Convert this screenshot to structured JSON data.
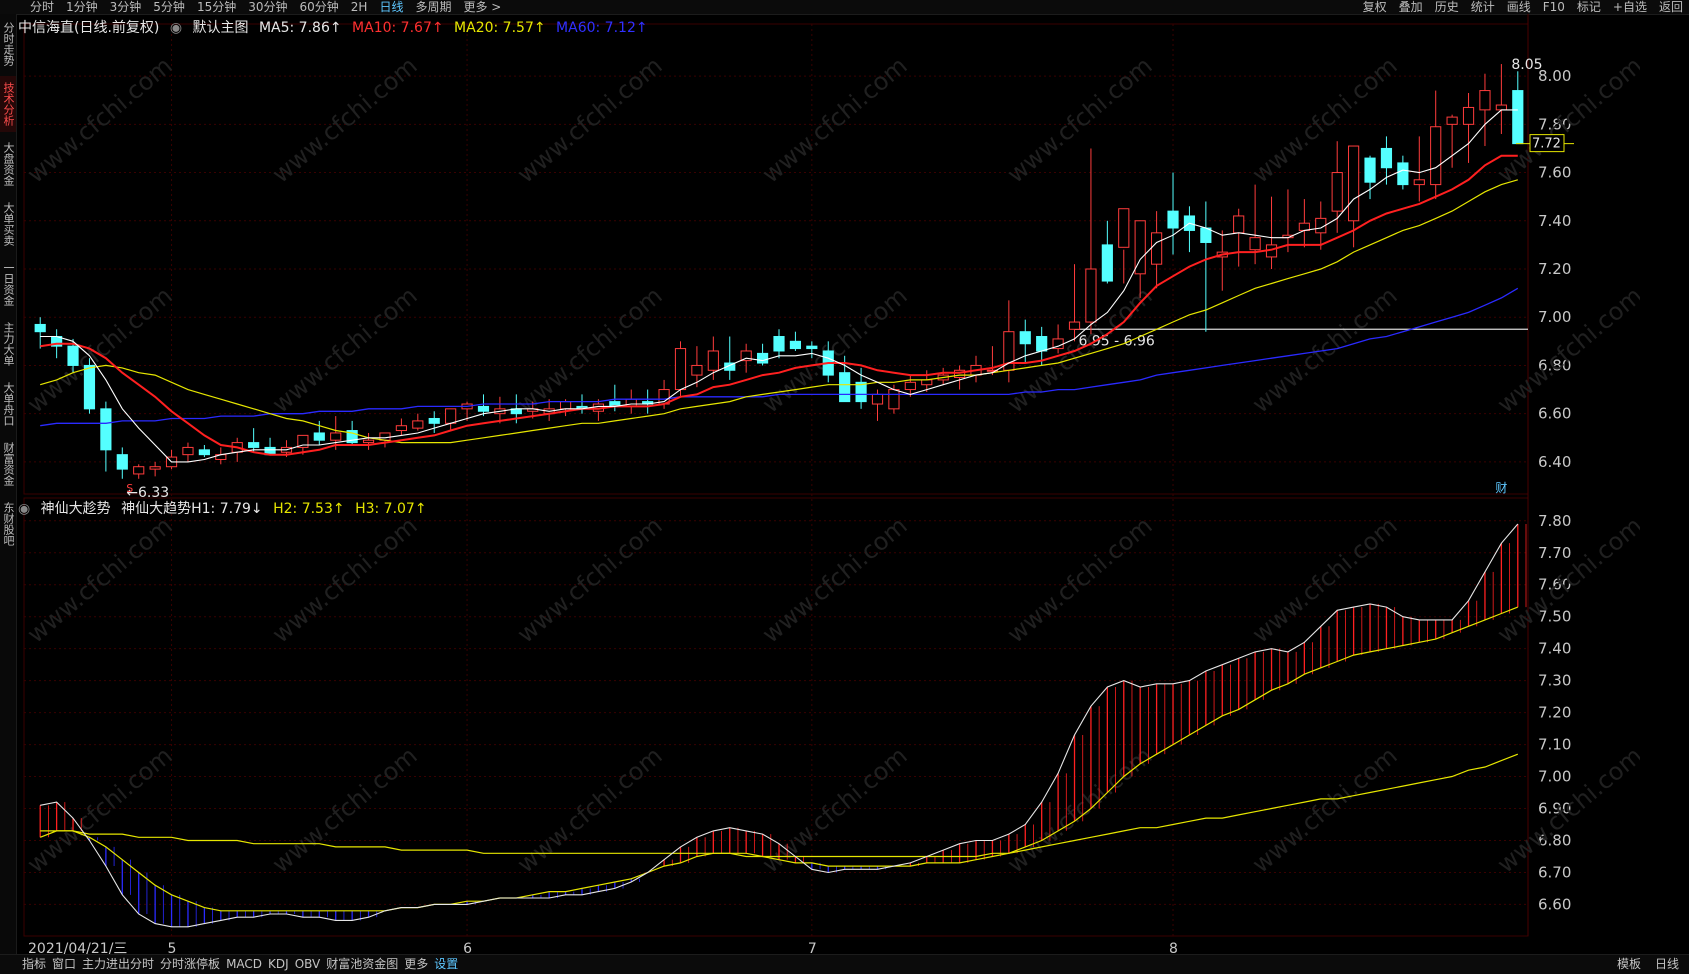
{
  "toolbar": {
    "left": [
      "分时",
      "1分钟",
      "3分钟",
      "5分钟",
      "15分钟",
      "30分钟",
      "60分钟",
      "2H",
      "日线",
      "多周期",
      "更多 >"
    ],
    "active": "日线",
    "right": [
      "复权",
      "叠加",
      "历史",
      "统计",
      "画线",
      "F10",
      "标记",
      "+自选",
      "返回"
    ]
  },
  "left_tabs": [
    {
      "label": "分时走势",
      "active": false
    },
    {
      "label": "技术分析",
      "active": true
    },
    {
      "label": "大盘资金",
      "active": false
    },
    {
      "label": "大单买卖",
      "active": false
    },
    {
      "label": "一日资金",
      "active": false
    },
    {
      "label": "主力大单",
      "active": false
    },
    {
      "label": "大单舟口",
      "active": false
    },
    {
      "label": "财富资金",
      "active": false
    },
    {
      "label": "东财股吧",
      "active": false
    }
  ],
  "header_main": {
    "stock": "中信海直(日线.前复权)",
    "chart_name": "默认主图",
    "ma5": "MA5: 7.86↑",
    "ma10": "MA10: 7.67↑",
    "ma20": "MA20: 7.57↑",
    "ma60": "MA60: 7.12↑"
  },
  "header_sub": {
    "indicator": "神仙大趁势",
    "h1": "神仙大趋势H1: 7.79↓",
    "h2": "H2: 7.53↑",
    "h3": "H3: 7.07↑"
  },
  "annotations": {
    "high": "8.05",
    "low": "←6.33",
    "line_label": "6.95 - 6.96",
    "current_price": "7.72",
    "finance_mark": "财",
    "s_mark": "S"
  },
  "bottom_date": "2021/04/21/三",
  "bottom_tabs": [
    "指标",
    "窗口",
    "主力进出分时",
    "分时涨停板",
    "MACD",
    "KDJ",
    "OBV",
    "财富池资金图",
    "更多",
    "设置"
  ],
  "bottom_active": "设置",
  "bottom_right": [
    "模板",
    "日线"
  ],
  "watermark": "www.cfchi.com",
  "colors": {
    "up": "#ff3c3c",
    "down": "#54ffff",
    "ma5": "#ffffff",
    "ma10": "#ff2020",
    "ma20": "#e6e600",
    "ma60": "#2a2aff",
    "grid": "#3a0000",
    "axis": "#c8c8c8"
  },
  "chart_data": [
    {
      "type": "candlestick",
      "x": [
        "2021/04/21",
        "2021/04/22",
        "2021/04/23",
        "2021/04/26",
        "2021/04/27",
        "2021/04/28",
        "2021/04/29",
        "2021/04/30",
        "2021/05/06",
        "2021/05/07",
        "2021/05/10",
        "2021/05/11",
        "2021/05/12",
        "2021/05/13",
        "2021/05/14",
        "2021/05/17",
        "2021/05/18",
        "2021/05/19",
        "2021/05/20",
        "2021/05/21",
        "2021/05/24",
        "2021/05/25",
        "2021/05/26",
        "2021/05/27",
        "2021/05/28",
        "2021/05/31",
        "2021/06/01",
        "2021/06/02",
        "2021/06/03",
        "2021/06/04",
        "2021/06/07",
        "2021/06/08",
        "2021/06/09",
        "2021/06/10",
        "2021/06/11",
        "2021/06/15",
        "2021/06/16",
        "2021/06/17",
        "2021/06/18",
        "2021/06/21",
        "2021/06/22",
        "2021/06/23",
        "2021/06/24",
        "2021/06/25",
        "2021/06/28",
        "2021/06/29",
        "2021/06/30",
        "2021/07/01",
        "2021/07/02",
        "2021/07/05",
        "2021/07/06",
        "2021/07/07",
        "2021/07/08",
        "2021/07/09",
        "2021/07/12",
        "2021/07/13",
        "2021/07/14",
        "2021/07/15",
        "2021/07/16",
        "2021/07/19",
        "2021/07/20",
        "2021/07/21",
        "2021/07/22",
        "2021/07/23",
        "2021/07/26",
        "2021/07/27",
        "2021/07/28",
        "2021/07/29",
        "2021/07/30",
        "2021/08/02",
        "2021/08/03",
        "2021/08/04",
        "2021/08/05",
        "2021/08/06",
        "2021/08/09",
        "2021/08/10",
        "2021/08/11",
        "2021/08/12",
        "2021/08/13",
        "2021/08/16",
        "2021/08/17",
        "2021/08/18",
        "2021/08/19",
        "2021/08/20",
        "2021/08/23",
        "2021/08/24",
        "2021/08/25",
        "2021/08/26",
        "2021/08/27",
        "2021/08/30",
        "2021/08/31"
      ],
      "open": [
        6.97,
        6.92,
        6.88,
        6.8,
        6.62,
        6.43,
        6.35,
        6.37,
        6.38,
        6.43,
        6.45,
        6.41,
        6.44,
        6.48,
        6.46,
        6.44,
        6.46,
        6.52,
        6.49,
        6.53,
        6.48,
        6.49,
        6.53,
        6.54,
        6.58,
        6.56,
        6.62,
        6.63,
        6.6,
        6.62,
        6.61,
        6.6,
        6.62,
        6.63,
        6.61,
        6.65,
        6.63,
        6.65,
        6.64,
        6.7,
        6.76,
        6.78,
        6.81,
        6.82,
        6.85,
        6.92,
        6.9,
        6.88,
        6.86,
        6.77,
        6.73,
        6.64,
        6.62,
        6.7,
        6.72,
        6.74,
        6.75,
        6.76,
        6.78,
        6.78,
        6.94,
        6.92,
        6.87,
        6.95,
        6.98,
        7.3,
        7.29,
        7.18,
        7.22,
        7.44,
        7.42,
        7.37,
        7.25,
        7.35,
        7.28,
        7.25,
        7.33,
        7.36,
        7.35,
        7.44,
        7.4,
        7.66,
        7.7,
        7.64,
        7.55,
        7.55,
        7.8,
        7.8,
        7.86,
        7.86,
        7.94
      ],
      "high": [
        7.0,
        6.95,
        6.91,
        6.83,
        6.65,
        6.46,
        6.39,
        6.4,
        6.45,
        6.48,
        6.47,
        6.46,
        6.5,
        6.54,
        6.5,
        6.49,
        6.51,
        6.57,
        6.59,
        6.57,
        6.52,
        6.52,
        6.58,
        6.6,
        6.61,
        6.61,
        6.65,
        6.68,
        6.67,
        6.68,
        6.65,
        6.66,
        6.66,
        6.68,
        6.66,
        6.72,
        6.7,
        6.7,
        6.74,
        6.9,
        6.88,
        6.92,
        6.92,
        6.89,
        6.89,
        6.95,
        6.94,
        6.9,
        6.9,
        6.84,
        6.79,
        6.7,
        6.72,
        6.76,
        6.78,
        6.79,
        6.8,
        6.84,
        6.88,
        7.07,
        6.99,
        6.96,
        6.97,
        7.22,
        7.7,
        7.4,
        7.28,
        7.37,
        7.44,
        7.6,
        7.46,
        7.48,
        7.36,
        7.45,
        7.55,
        7.5,
        7.53,
        7.49,
        7.48,
        7.73,
        7.71,
        7.67,
        7.75,
        7.67,
        7.75,
        7.94,
        7.84,
        7.93,
        8.01,
        8.05,
        8.02
      ],
      "low": [
        6.87,
        6.83,
        6.77,
        6.6,
        6.36,
        6.33,
        6.33,
        6.34,
        6.37,
        6.4,
        6.42,
        6.39,
        6.4,
        6.44,
        6.43,
        6.42,
        6.43,
        6.47,
        6.45,
        6.47,
        6.45,
        6.46,
        6.51,
        6.53,
        6.52,
        6.53,
        6.57,
        6.59,
        6.56,
        6.56,
        6.58,
        6.57,
        6.59,
        6.6,
        6.57,
        6.61,
        6.6,
        6.6,
        6.62,
        6.67,
        6.71,
        6.74,
        6.74,
        6.77,
        6.8,
        6.83,
        6.86,
        6.83,
        6.73,
        6.7,
        6.62,
        6.57,
        6.6,
        6.67,
        6.69,
        6.72,
        6.7,
        6.73,
        6.76,
        6.73,
        6.81,
        6.8,
        6.85,
        6.9,
        6.93,
        7.14,
        7.14,
        7.08,
        7.12,
        7.26,
        7.27,
        6.94,
        7.11,
        7.21,
        7.22,
        7.2,
        7.27,
        7.29,
        7.28,
        7.35,
        7.29,
        7.49,
        7.55,
        7.53,
        7.48,
        7.49,
        7.62,
        7.64,
        7.71,
        7.76,
        7.78
      ],
      "close": [
        6.94,
        6.88,
        6.8,
        6.62,
        6.45,
        6.37,
        6.38,
        6.38,
        6.42,
        6.46,
        6.43,
        6.43,
        6.48,
        6.46,
        6.43,
        6.46,
        6.51,
        6.49,
        6.52,
        6.48,
        6.49,
        6.52,
        6.55,
        6.57,
        6.56,
        6.62,
        6.64,
        6.61,
        6.62,
        6.6,
        6.62,
        6.62,
        6.65,
        6.62,
        6.64,
        6.63,
        6.66,
        6.64,
        6.7,
        6.87,
        6.8,
        6.86,
        6.78,
        6.86,
        6.81,
        6.86,
        6.87,
        6.87,
        6.76,
        6.65,
        6.65,
        6.68,
        6.7,
        6.73,
        6.74,
        6.76,
        6.78,
        6.8,
        6.78,
        6.94,
        6.89,
        6.86,
        6.91,
        6.98,
        7.2,
        7.15,
        7.45,
        7.4,
        7.35,
        7.37,
        7.36,
        7.31,
        7.27,
        7.42,
        7.33,
        7.3,
        7.34,
        7.39,
        7.41,
        7.6,
        7.71,
        7.56,
        7.62,
        7.55,
        7.57,
        7.79,
        7.83,
        7.87,
        7.94,
        7.88,
        7.72
      ],
      "ma5": [
        6.92,
        6.92,
        6.9,
        6.84,
        6.74,
        6.62,
        6.54,
        6.47,
        6.4,
        6.4,
        6.41,
        6.43,
        6.44,
        6.45,
        6.45,
        6.45,
        6.47,
        6.47,
        6.48,
        6.49,
        6.5,
        6.5,
        6.51,
        6.52,
        6.54,
        6.56,
        6.58,
        6.6,
        6.61,
        6.62,
        6.62,
        6.61,
        6.62,
        6.62,
        6.63,
        6.63,
        6.64,
        6.64,
        6.65,
        6.7,
        6.73,
        6.77,
        6.8,
        6.83,
        6.82,
        6.84,
        6.84,
        6.85,
        6.83,
        6.8,
        6.76,
        6.73,
        6.7,
        6.68,
        6.7,
        6.72,
        6.74,
        6.76,
        6.77,
        6.81,
        6.84,
        6.86,
        6.88,
        6.91,
        6.97,
        7.02,
        7.11,
        7.24,
        7.31,
        7.34,
        7.39,
        7.37,
        7.34,
        7.35,
        7.34,
        7.33,
        7.33,
        7.36,
        7.37,
        7.41,
        7.49,
        7.53,
        7.58,
        7.61,
        7.6,
        7.62,
        7.67,
        7.72,
        7.8,
        7.86,
        7.86
      ],
      "ma10": [
        6.88,
        6.89,
        6.89,
        6.87,
        6.83,
        6.77,
        6.72,
        6.67,
        6.61,
        6.56,
        6.51,
        6.47,
        6.46,
        6.44,
        6.43,
        6.43,
        6.44,
        6.45,
        6.47,
        6.47,
        6.47,
        6.48,
        6.49,
        6.5,
        6.51,
        6.53,
        6.55,
        6.56,
        6.57,
        6.58,
        6.59,
        6.6,
        6.61,
        6.62,
        6.62,
        6.63,
        6.63,
        6.63,
        6.64,
        6.67,
        6.68,
        6.71,
        6.72,
        6.74,
        6.76,
        6.77,
        6.79,
        6.8,
        6.81,
        6.81,
        6.8,
        6.78,
        6.77,
        6.76,
        6.76,
        6.77,
        6.77,
        6.78,
        6.79,
        6.81,
        6.81,
        6.82,
        6.84,
        6.86,
        6.89,
        6.93,
        6.98,
        7.06,
        7.13,
        7.17,
        7.21,
        7.24,
        7.26,
        7.27,
        7.27,
        7.28,
        7.3,
        7.3,
        7.3,
        7.33,
        7.36,
        7.4,
        7.43,
        7.45,
        7.47,
        7.5,
        7.53,
        7.57,
        7.63,
        7.67,
        7.67
      ],
      "ma20": [
        6.72,
        6.74,
        6.77,
        6.79,
        6.8,
        6.79,
        6.77,
        6.76,
        6.73,
        6.7,
        6.68,
        6.66,
        6.64,
        6.62,
        6.6,
        6.58,
        6.57,
        6.55,
        6.53,
        6.52,
        6.5,
        6.49,
        6.48,
        6.48,
        6.48,
        6.48,
        6.49,
        6.5,
        6.51,
        6.52,
        6.53,
        6.54,
        6.55,
        6.56,
        6.56,
        6.57,
        6.58,
        6.59,
        6.6,
        6.62,
        6.63,
        6.64,
        6.65,
        6.67,
        6.68,
        6.69,
        6.7,
        6.71,
        6.72,
        6.72,
        6.72,
        6.73,
        6.73,
        6.74,
        6.74,
        6.75,
        6.76,
        6.76,
        6.77,
        6.78,
        6.79,
        6.8,
        6.81,
        6.83,
        6.85,
        6.87,
        6.89,
        6.92,
        6.95,
        6.98,
        7.01,
        7.03,
        7.06,
        7.09,
        7.12,
        7.14,
        7.16,
        7.18,
        7.2,
        7.23,
        7.27,
        7.3,
        7.33,
        7.36,
        7.38,
        7.41,
        7.44,
        7.48,
        7.52,
        7.55,
        7.57
      ],
      "ma60": [
        6.55,
        6.56,
        6.56,
        6.56,
        6.56,
        6.57,
        6.57,
        6.57,
        6.58,
        6.58,
        6.58,
        6.59,
        6.59,
        6.59,
        6.6,
        6.6,
        6.6,
        6.61,
        6.61,
        6.61,
        6.62,
        6.62,
        6.62,
        6.63,
        6.63,
        6.63,
        6.63,
        6.64,
        6.64,
        6.64,
        6.64,
        6.65,
        6.65,
        6.65,
        6.65,
        6.66,
        6.66,
        6.66,
        6.66,
        6.67,
        6.67,
        6.67,
        6.67,
        6.67,
        6.67,
        6.68,
        6.68,
        6.68,
        6.68,
        6.68,
        6.68,
        6.68,
        6.68,
        6.68,
        6.68,
        6.68,
        6.68,
        6.68,
        6.68,
        6.68,
        6.69,
        6.69,
        6.7,
        6.7,
        6.71,
        6.72,
        6.73,
        6.74,
        6.76,
        6.77,
        6.78,
        6.79,
        6.8,
        6.81,
        6.82,
        6.83,
        6.84,
        6.85,
        6.86,
        6.87,
        6.89,
        6.91,
        6.92,
        6.94,
        6.96,
        6.98,
        7.0,
        7.02,
        7.05,
        7.08,
        7.12
      ],
      "ylim": [
        6.3,
        8.1
      ],
      "month_labels": [
        {
          "label": "5",
          "index": 8
        },
        {
          "label": "6",
          "index": 26
        },
        {
          "label": "7",
          "index": 47
        },
        {
          "label": "8",
          "index": 69
        }
      ],
      "y_ticks": [
        8.0,
        7.8,
        7.6,
        7.4,
        7.2,
        7.0,
        6.8,
        6.6,
        6.4
      ],
      "hline": 6.95
    },
    {
      "type": "band",
      "h1": [
        6.91,
        6.92,
        6.87,
        6.8,
        6.72,
        6.63,
        6.57,
        6.54,
        6.53,
        6.53,
        6.54,
        6.55,
        6.56,
        6.56,
        6.57,
        6.57,
        6.56,
        6.56,
        6.55,
        6.55,
        6.56,
        6.58,
        6.59,
        6.59,
        6.6,
        6.6,
        6.6,
        6.61,
        6.62,
        6.62,
        6.62,
        6.62,
        6.63,
        6.63,
        6.64,
        6.65,
        6.67,
        6.7,
        6.74,
        6.78,
        6.81,
        6.83,
        6.84,
        6.83,
        6.82,
        6.79,
        6.75,
        6.71,
        6.7,
        6.71,
        6.71,
        6.71,
        6.72,
        6.73,
        6.75,
        6.77,
        6.79,
        6.8,
        6.8,
        6.82,
        6.85,
        6.92,
        7.01,
        7.13,
        7.22,
        7.28,
        7.3,
        7.28,
        7.29,
        7.29,
        7.3,
        7.33,
        7.35,
        7.37,
        7.39,
        7.4,
        7.39,
        7.42,
        7.47,
        7.52,
        7.53,
        7.54,
        7.53,
        7.5,
        7.49,
        7.49,
        7.49,
        7.55,
        7.64,
        7.73,
        7.79
      ],
      "h2": [
        6.81,
        6.83,
        6.83,
        6.81,
        6.78,
        6.74,
        6.7,
        6.66,
        6.63,
        6.61,
        6.59,
        6.58,
        6.58,
        6.58,
        6.58,
        6.58,
        6.58,
        6.58,
        6.58,
        6.58,
        6.58,
        6.58,
        6.59,
        6.59,
        6.6,
        6.6,
        6.61,
        6.61,
        6.62,
        6.62,
        6.63,
        6.64,
        6.64,
        6.65,
        6.66,
        6.67,
        6.68,
        6.7,
        6.72,
        6.73,
        6.75,
        6.76,
        6.76,
        6.76,
        6.75,
        6.74,
        6.73,
        6.73,
        6.72,
        6.72,
        6.72,
        6.72,
        6.72,
        6.72,
        6.73,
        6.73,
        6.73,
        6.74,
        6.75,
        6.76,
        6.78,
        6.8,
        6.83,
        6.86,
        6.9,
        6.95,
        7.0,
        7.04,
        7.07,
        7.1,
        7.13,
        7.16,
        7.19,
        7.21,
        7.24,
        7.27,
        7.29,
        7.32,
        7.34,
        7.36,
        7.38,
        7.39,
        7.4,
        7.41,
        7.42,
        7.43,
        7.45,
        7.47,
        7.49,
        7.51,
        7.53
      ],
      "h3": [
        6.83,
        6.83,
        6.83,
        6.82,
        6.82,
        6.82,
        6.81,
        6.81,
        6.81,
        6.8,
        6.8,
        6.8,
        6.8,
        6.79,
        6.79,
        6.79,
        6.79,
        6.79,
        6.78,
        6.78,
        6.78,
        6.78,
        6.77,
        6.77,
        6.77,
        6.77,
        6.77,
        6.76,
        6.76,
        6.76,
        6.76,
        6.76,
        6.76,
        6.76,
        6.76,
        6.76,
        6.76,
        6.76,
        6.76,
        6.76,
        6.76,
        6.76,
        6.76,
        6.75,
        6.75,
        6.75,
        6.75,
        6.75,
        6.75,
        6.75,
        6.75,
        6.75,
        6.75,
        6.75,
        6.75,
        6.75,
        6.75,
        6.75,
        6.76,
        6.76,
        6.77,
        6.78,
        6.79,
        6.8,
        6.81,
        6.82,
        6.83,
        6.84,
        6.84,
        6.85,
        6.86,
        6.87,
        6.87,
        6.88,
        6.89,
        6.9,
        6.91,
        6.92,
        6.93,
        6.93,
        6.94,
        6.95,
        6.96,
        6.97,
        6.98,
        6.99,
        7.0,
        7.02,
        7.03,
        7.05,
        7.07
      ],
      "ylim": [
        6.52,
        7.84
      ],
      "y_ticks": [
        7.8,
        7.7,
        7.6,
        7.5,
        7.4,
        7.3,
        7.2,
        7.1,
        7.0,
        6.9,
        6.8,
        6.7,
        6.6
      ]
    }
  ]
}
